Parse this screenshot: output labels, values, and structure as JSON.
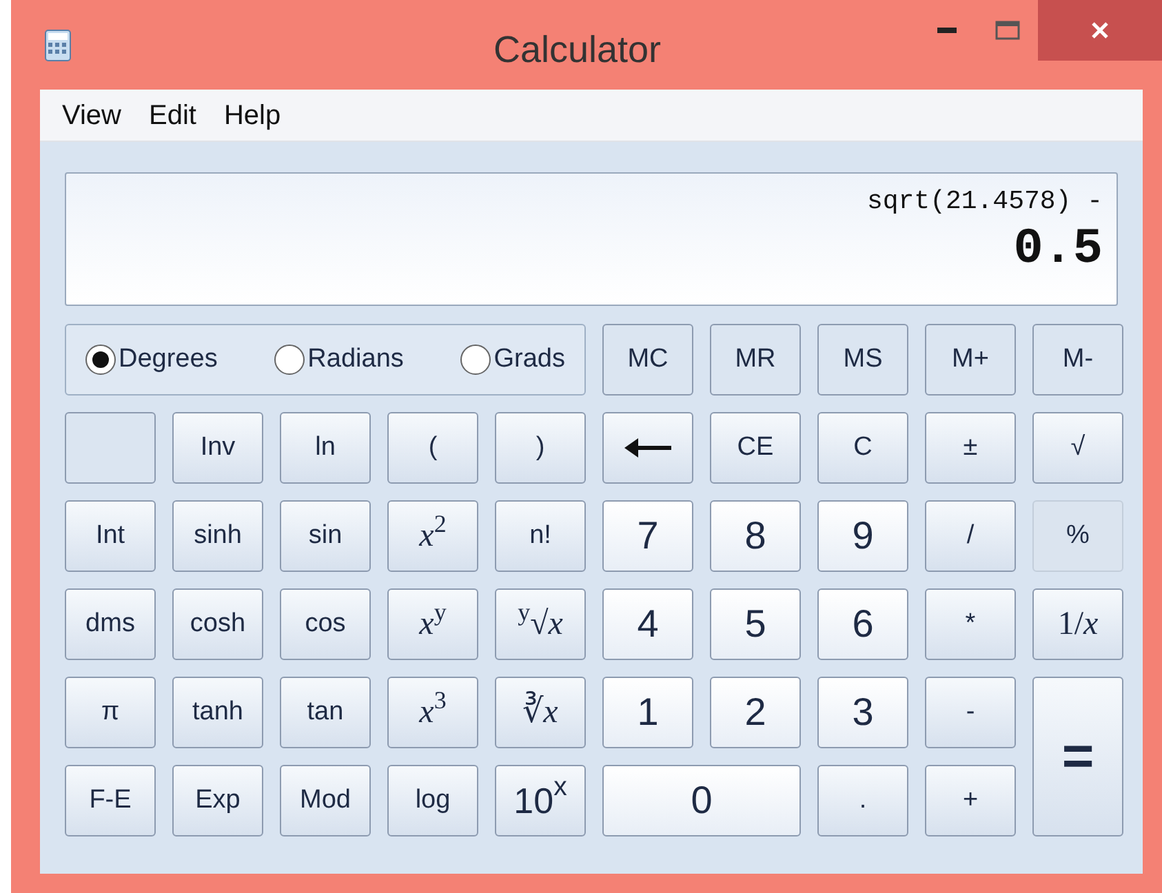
{
  "window": {
    "title": "Calculator"
  },
  "menu": [
    "View",
    "Edit",
    "Help"
  ],
  "display": {
    "expression": "sqrt(21.4578) -",
    "value": "0.5"
  },
  "angle_modes": [
    {
      "label": "Degrees",
      "selected": true
    },
    {
      "label": "Radians",
      "selected": false
    },
    {
      "label": "Grads",
      "selected": false
    }
  ],
  "memory_buttons": [
    "MC",
    "MR",
    "MS",
    "M+",
    "M-"
  ],
  "keys": [
    {
      "kind": "blank"
    },
    {
      "kind": "plain",
      "label": "Inv"
    },
    {
      "kind": "plain",
      "label": "ln"
    },
    {
      "kind": "plain",
      "label": "("
    },
    {
      "kind": "plain",
      "label": ")"
    },
    {
      "kind": "backspace"
    },
    {
      "kind": "plain",
      "label": "CE"
    },
    {
      "kind": "plain",
      "label": "C"
    },
    {
      "kind": "plain",
      "label": "±"
    },
    {
      "kind": "plain",
      "label": "√"
    },
    {
      "kind": "plain",
      "label": "Int"
    },
    {
      "kind": "plain",
      "label": "sinh"
    },
    {
      "kind": "plain",
      "label": "sin"
    },
    {
      "kind": "math",
      "label": "*x*$^{2}$"
    },
    {
      "kind": "plain",
      "label": "n!"
    },
    {
      "kind": "digit",
      "label": "7"
    },
    {
      "kind": "digit",
      "label": "8"
    },
    {
      "kind": "digit",
      "label": "9"
    },
    {
      "kind": "plain",
      "label": "/"
    },
    {
      "kind": "flat",
      "label": "%"
    },
    {
      "kind": "plain",
      "label": "dms"
    },
    {
      "kind": "plain",
      "label": "cosh"
    },
    {
      "kind": "plain",
      "label": "cos"
    },
    {
      "kind": "math",
      "label": "*x*$^{y}$"
    },
    {
      "kind": "math",
      "label": "$^{y}$√*x*"
    },
    {
      "kind": "digit",
      "label": "4"
    },
    {
      "kind": "digit",
      "label": "5"
    },
    {
      "kind": "digit",
      "label": "6"
    },
    {
      "kind": "plain",
      "label": "*"
    },
    {
      "kind": "math",
      "label": "1/*x*"
    },
    {
      "kind": "plain",
      "label": "π"
    },
    {
      "kind": "plain",
      "label": "tanh"
    },
    {
      "kind": "plain",
      "label": "tan"
    },
    {
      "kind": "math",
      "label": "*x*$^{3}$"
    },
    {
      "kind": "math",
      "label": "∛*x*"
    },
    {
      "kind": "digit",
      "label": "1"
    },
    {
      "kind": "digit",
      "label": "2"
    },
    {
      "kind": "digit",
      "label": "3"
    },
    {
      "kind": "plain",
      "label": "-"
    },
    {
      "kind": "tall",
      "label": "="
    },
    {
      "kind": "plain",
      "label": "F-E"
    },
    {
      "kind": "plain",
      "label": "Exp"
    },
    {
      "kind": "plain",
      "label": "Mod"
    },
    {
      "kind": "plain",
      "label": "log"
    },
    {
      "kind": "digitpow",
      "label": "10$^{x}$"
    },
    {
      "kind": "wide",
      "label": "0"
    },
    {
      "kind": "plain",
      "label": "."
    },
    {
      "kind": "plain",
      "label": "+"
    }
  ]
}
